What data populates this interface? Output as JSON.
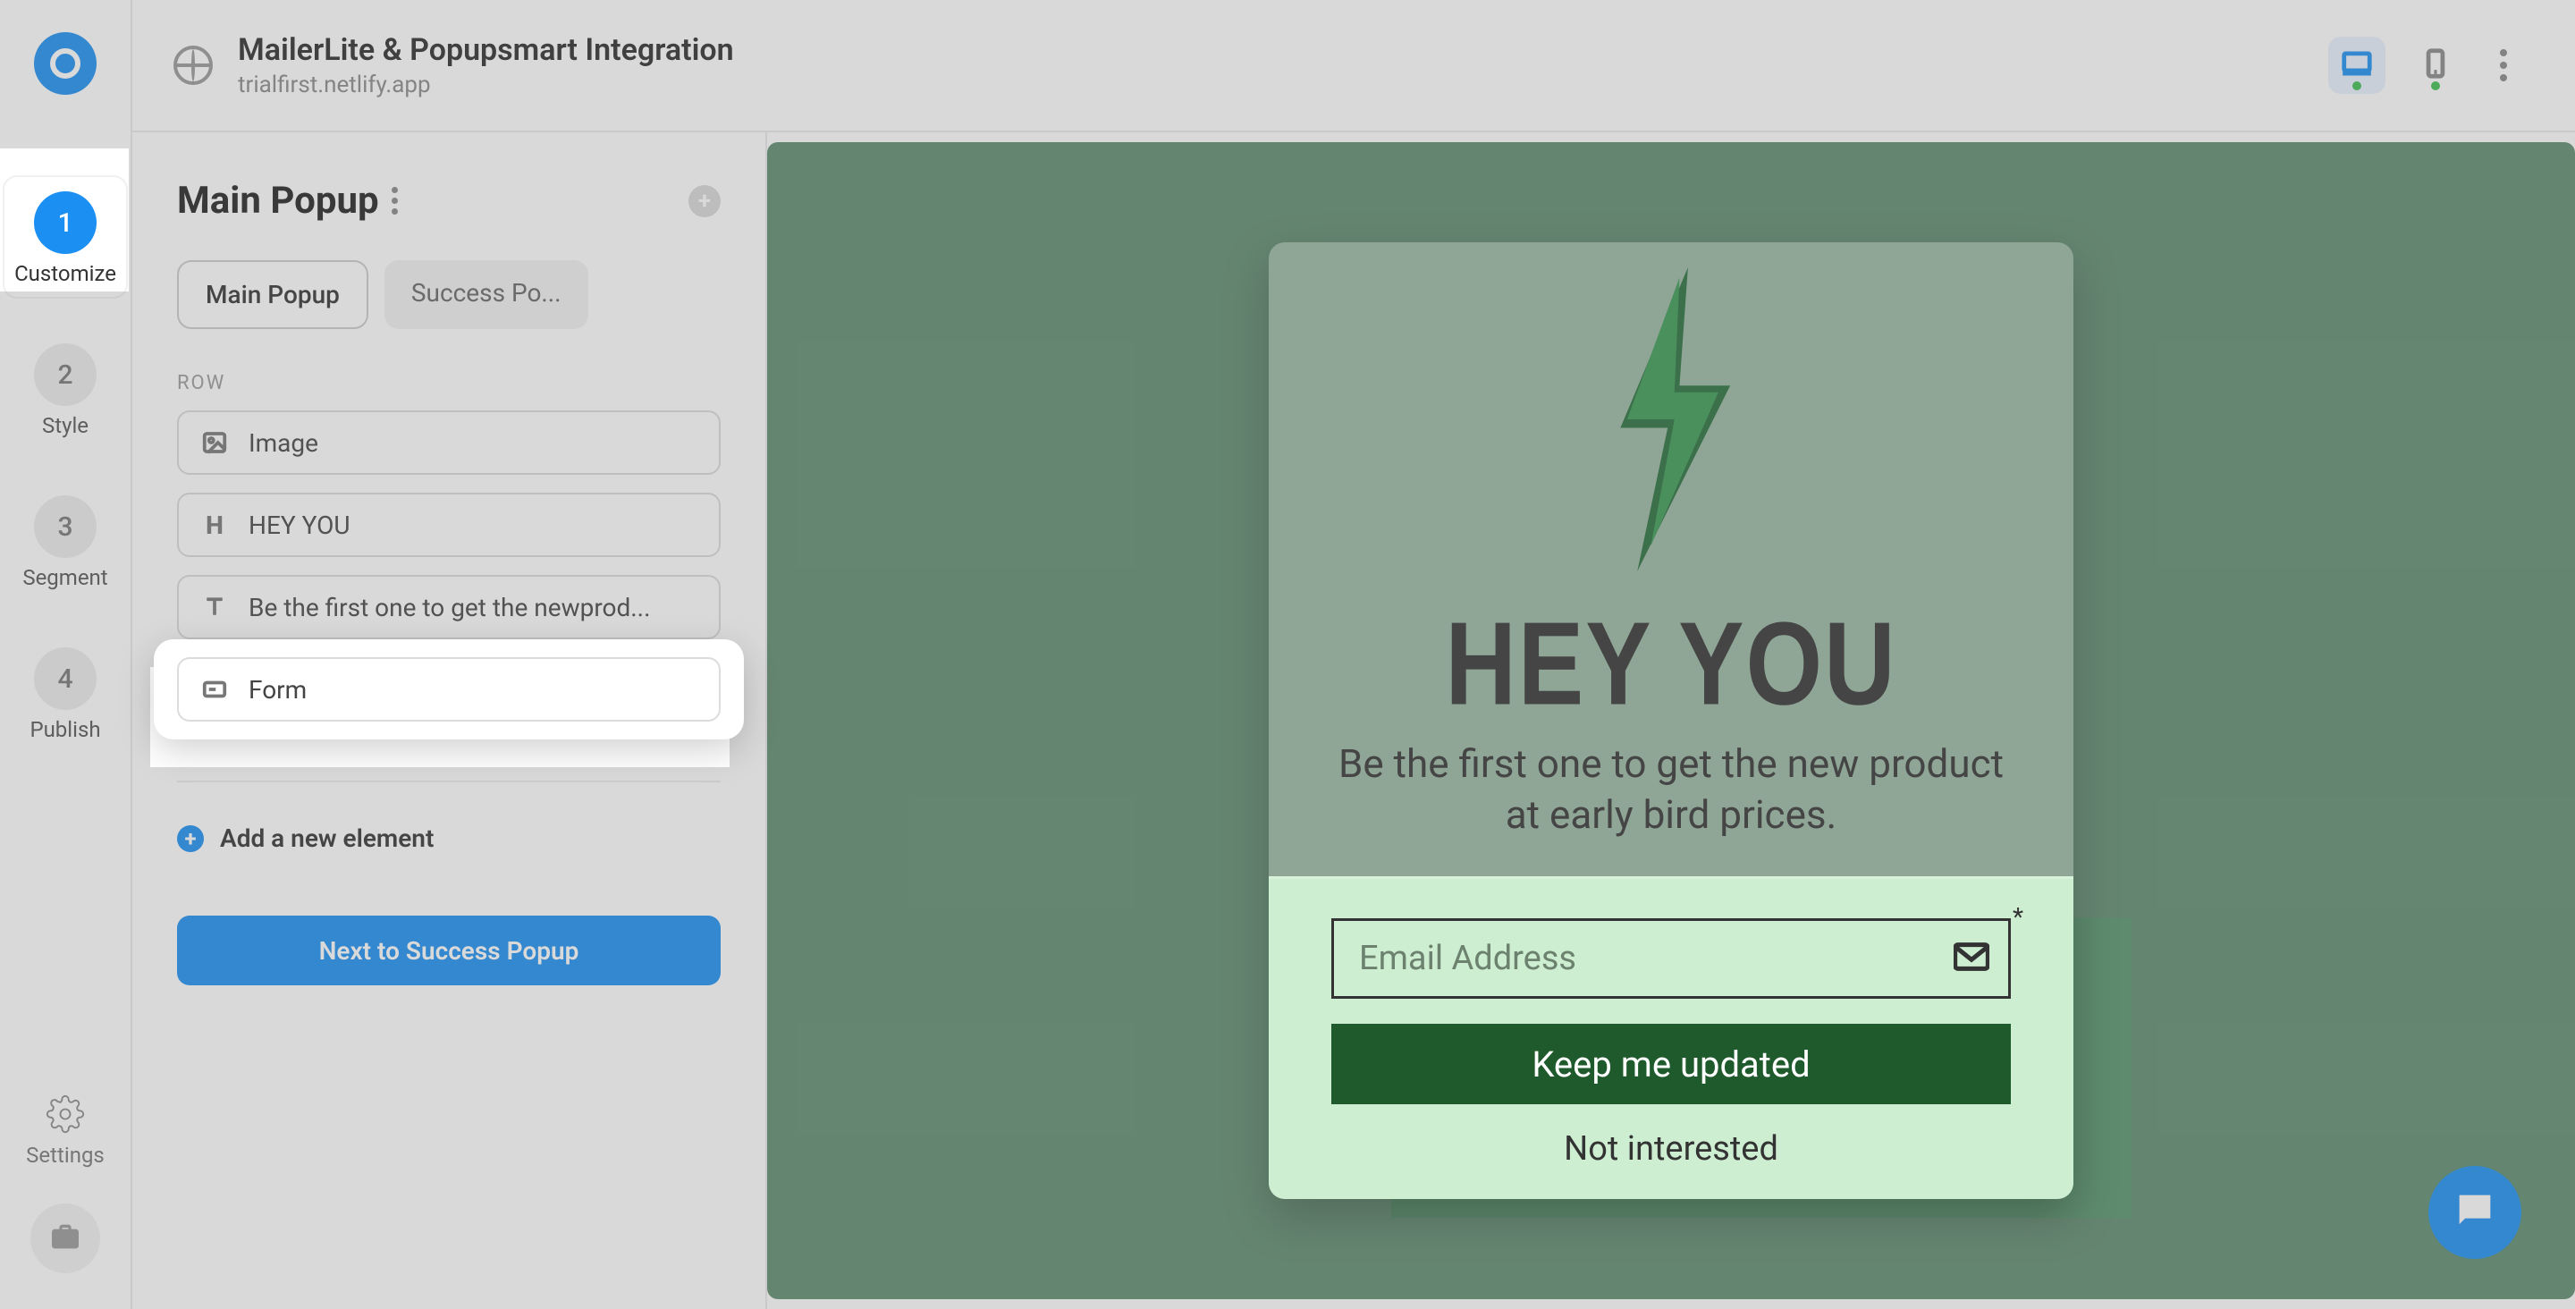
{
  "topbar": {
    "title": "MailerLite & Popupsmart Integration",
    "subtitle": "trialfirst.netlify.app"
  },
  "rail": {
    "steps": [
      {
        "num": "1",
        "label": "Customize"
      },
      {
        "num": "2",
        "label": "Style"
      },
      {
        "num": "3",
        "label": "Segment"
      },
      {
        "num": "4",
        "label": "Publish"
      }
    ],
    "settings_label": "Settings"
  },
  "panel": {
    "title": "Main Popup",
    "tabs": {
      "main": "Main Popup",
      "success": "Success Po..."
    },
    "row_label": "ROW",
    "rows": {
      "image": "Image",
      "heading": "HEY YOU",
      "text": "Be the first one to get the newprod...",
      "form": "Form"
    },
    "add_new": "Add a new element",
    "next": "Next to Success Popup"
  },
  "popup": {
    "heading": "HEY YOU",
    "sub": "Be the first one to get the new product at early bird prices.",
    "email_placeholder": "Email Address",
    "cta": "Keep me updated",
    "not_interested": "Not interested"
  }
}
